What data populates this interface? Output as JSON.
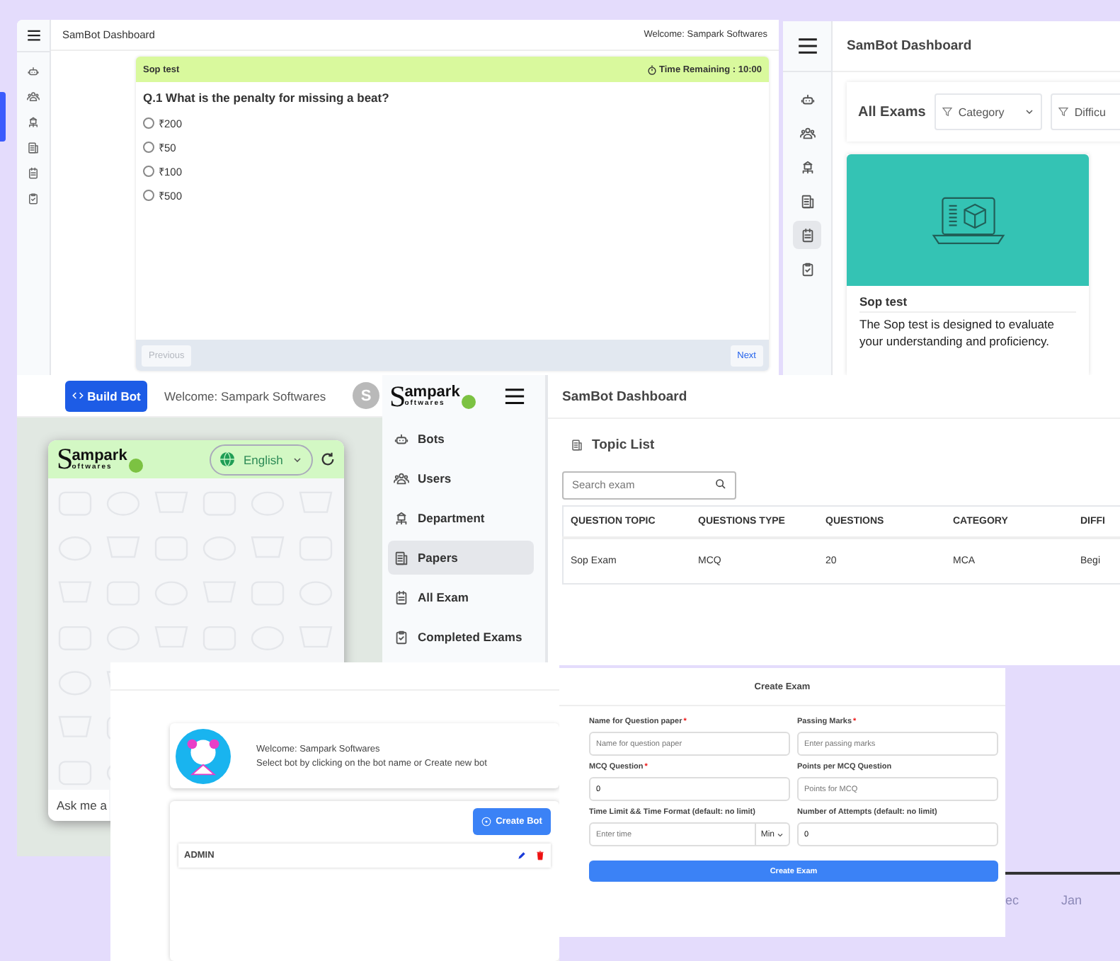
{
  "quiz_window": {
    "title": "SamBot Dashboard",
    "welcome": "Welcome: Sampark Softwares",
    "nav": [
      {
        "kind": "bot",
        "selected": false
      },
      {
        "kind": "users",
        "selected": false
      },
      {
        "kind": "department",
        "selected": false
      },
      {
        "kind": "papers",
        "selected": false
      },
      {
        "kind": "exam",
        "selected": false
      },
      {
        "kind": "completed",
        "selected": false
      }
    ],
    "exam_name": "Sop test",
    "timer": "Time Remaining : 10:00",
    "question": "Q.1 What is the penalty for missing a beat?",
    "options": [
      {
        "label": "₹200",
        "selected": false
      },
      {
        "label": "₹50",
        "selected": false
      },
      {
        "label": "₹100",
        "selected": false
      },
      {
        "label": "₹500",
        "selected": false
      }
    ],
    "buttons": [
      {
        "label": "Previous",
        "disabled": true
      },
      {
        "label": "Next",
        "disabled": false
      }
    ]
  },
  "exams_window": {
    "title": "SamBot Dashboard",
    "nav": [
      {
        "kind": "bot",
        "selected": false
      },
      {
        "kind": "users",
        "selected": false
      },
      {
        "kind": "department",
        "selected": false
      },
      {
        "kind": "papers",
        "selected": false
      },
      {
        "kind": "exam",
        "selected": true
      },
      {
        "kind": "completed",
        "selected": false
      }
    ],
    "heading": "All Exams",
    "filters": [
      "Category",
      "Difficu"
    ],
    "card": {
      "title": "Sop test",
      "description": "The Sop test is designed to evaluate your understanding and proficiency."
    }
  },
  "bot_builder": {
    "build_button": "Build Bot",
    "welcome": "Welcome: Sampark Softwares",
    "avatar_letter": "S",
    "menu_logo": {
      "initial": "S",
      "top": "ampark",
      "bottom": "oftwares"
    },
    "chat": {
      "logo": {
        "initial": "S",
        "top": "ampark",
        "bottom": "oftwares"
      },
      "language": "English",
      "input_placeholder": "Ask me a"
    },
    "menu": [
      {
        "kind": "bot",
        "label": "Bots",
        "selected": false
      },
      {
        "kind": "users",
        "label": "Users",
        "selected": false
      },
      {
        "kind": "department",
        "label": "Department",
        "selected": false
      },
      {
        "kind": "papers",
        "label": "Papers",
        "selected": true
      },
      {
        "kind": "exam",
        "label": "All Exam",
        "selected": false
      },
      {
        "kind": "completed",
        "label": "Completed Exams",
        "selected": false
      }
    ]
  },
  "topic_window": {
    "title": "SamBot Dashboard",
    "heading": "Topic List",
    "search": {
      "placeholder": "Search exam"
    },
    "table": {
      "columns": [
        "QUESTION TOPIC",
        "QUESTIONS TYPE",
        "QUESTIONS",
        "CATEGORY",
        "DIFFI"
      ],
      "rows": [
        [
          "Sop Exam",
          "MCQ",
          "20",
          "MCA",
          "Begi"
        ]
      ]
    }
  },
  "bot_select_window": {
    "welcome": "Welcome: Sampark Softwares",
    "hint": "Select bot by clicking on the bot name or Create new bot",
    "create_button": "Create Bot",
    "bots": [
      "ADMIN"
    ]
  },
  "create_exam_window": {
    "title": "Create Exam",
    "fields": [
      {
        "label": "Name for Question paper",
        "required_mark": "*",
        "placeholder": "Name for question paper"
      },
      {
        "label": "Passing Marks",
        "required_mark": "*",
        "placeholder": "Enter passing marks"
      },
      {
        "label": "MCQ Question",
        "required_mark": "*",
        "value": "0"
      },
      {
        "label": "Points per MCQ Question",
        "placeholder": "Points for MCQ"
      },
      {
        "label": "Time Limit && Time Format (default: no limit)",
        "placeholder": "Enter time",
        "unit": "Min"
      },
      {
        "label": "Number of Attempts (default: no limit)",
        "value": "0"
      }
    ],
    "submit": "Create Exam"
  },
  "chart_axis_labels": [
    "ec",
    "Jan"
  ]
}
